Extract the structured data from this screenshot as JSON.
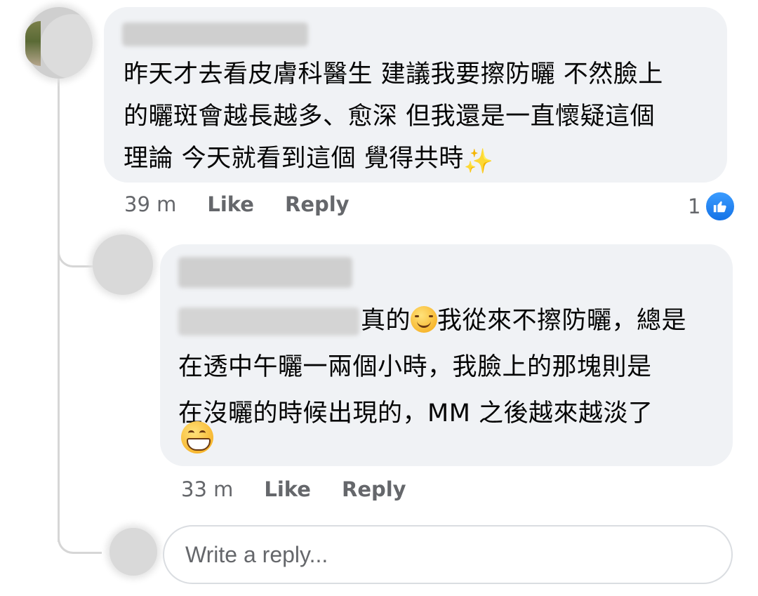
{
  "comment": {
    "author": "",
    "text_lines": [
      "昨天才去看皮膚科醫生 建議我要擦防曬 不然臉上",
      "的曬斑會越長越多、愈深 但我還是一直懷疑這個",
      "理論 今天就看到這個 覺得共時"
    ],
    "trailing_icon": "sparkles-icon",
    "time": "39 m",
    "like_label": "Like",
    "reply_label": "Reply",
    "reaction_count": "1",
    "reaction_icon": "thumbs-up-icon",
    "reaction_color": "#1877f2"
  },
  "reply": {
    "author": "",
    "line1_text": "真的",
    "line1_emoji": "smiling-face-icon",
    "line1_rest": "我從來不擦防曬，總是",
    "text_lines": [
      "在透中午曬一兩個小時，我臉上的那塊則是",
      "在沒曬的時候出現的，MM 之後越來越淡了"
    ],
    "trailing_icon": "grinning-face-icon",
    "time": "33 m",
    "like_label": "Like",
    "reply_label": "Reply"
  },
  "composer": {
    "placeholder": "Write a reply..."
  }
}
